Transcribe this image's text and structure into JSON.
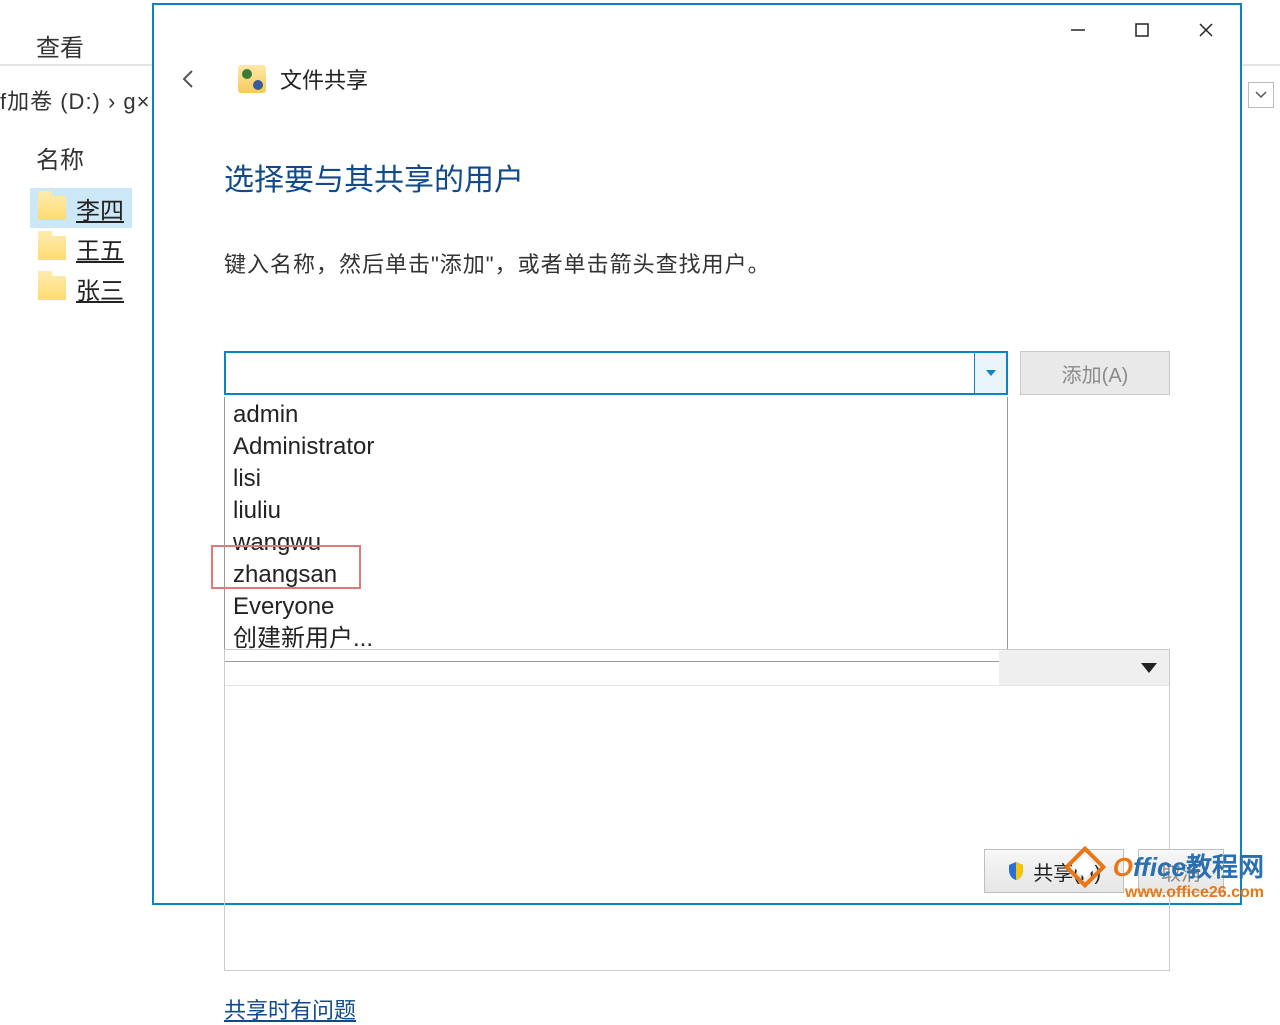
{
  "explorer": {
    "view_tab": "查看",
    "path": "f加卷 (D:)  ›  g×",
    "column_name": "名称",
    "folders": [
      {
        "label": "李四",
        "selected": true
      },
      {
        "label": "王五",
        "selected": false
      },
      {
        "label": "张三",
        "selected": false
      }
    ]
  },
  "dialog": {
    "app_title": "文件共享",
    "title": "选择要与其共享的用户",
    "subtitle": "键入名称，然后单击\"添加\"，或者单击箭头查找用户。",
    "input_value": "",
    "add_button": "添加(A)",
    "dropdown_options": [
      "admin",
      "Administrator",
      "lisi",
      "liuliu",
      "wangwu",
      "zhangsan",
      "Everyone",
      "创建新用户..."
    ],
    "highlighted_option": "zhangsan",
    "help_link": "共享时有问题",
    "footer": {
      "share": "共享(H)",
      "cancel": "取消"
    }
  },
  "watermark": {
    "brand_o": "O",
    "brand_rest": "ffice",
    "brand_cn": "教程网",
    "url": "www.office26.com"
  }
}
